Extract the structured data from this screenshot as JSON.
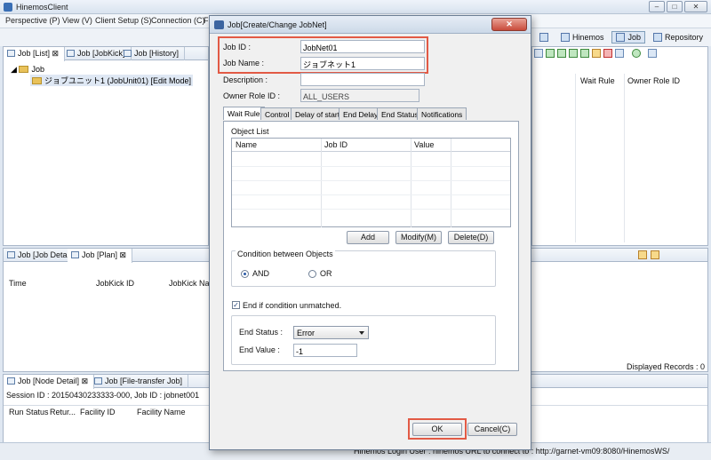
{
  "window": {
    "title": "HinemosClient",
    "min_glyph": "–",
    "max_glyph": "□",
    "close_glyph": "✕"
  },
  "menu": {
    "items": [
      "Perspective (P)",
      "View (V)",
      "Client Setup (S)",
      "Connection (C)",
      "F"
    ]
  },
  "perspectives": {
    "items": [
      "Hinemos",
      "Job",
      "Repository"
    ],
    "active": "Job"
  },
  "left_panel": {
    "tabs": [
      "Job [List]",
      "Job [JobKick]",
      "Job [History]"
    ],
    "tree": {
      "root": "Job",
      "child": "ジョブユニット1 (JobUnit01) [Edit Mode]"
    }
  },
  "right_panel": {
    "columns": [
      "Wait Rule",
      "Owner Role ID"
    ]
  },
  "plan_panel": {
    "tabs": [
      "Job [Job Detail]",
      "Job [Plan]"
    ],
    "columns": [
      "Time",
      "JobKick ID",
      "JobKick Name"
    ],
    "displayed_records": "Displayed Records : 0"
  },
  "node_panel": {
    "tabs": [
      "Job [Node Detail]",
      "Job [File-transfer Job]"
    ],
    "session_line": "Session ID : 20150430233333-000,   Job ID : jobnet001",
    "columns": [
      "Run Status",
      "Retur...",
      "Facility ID",
      "Facility Name"
    ]
  },
  "status": {
    "text": "Hinemos Login User : hinemos      URL to connect to : http://garnet-vm09:8080/HinemosWS/"
  },
  "dialog": {
    "title": "Job[Create/Change JobNet]",
    "close_label": "✕",
    "job_id_label": "Job ID :",
    "job_id_value": "JobNet01",
    "job_name_label": "Job Name :",
    "job_name_value": "ジョブネット1",
    "description_label": "Description :",
    "description_value": "",
    "owner_role_label": "Owner Role ID :",
    "owner_role_value": "ALL_USERS",
    "tabs": [
      "Wait Rule",
      "Control",
      "Delay of start",
      "End Delay",
      "End Status",
      "Notifications"
    ],
    "active_tab": "Wait Rule",
    "object_list_label": "Object List",
    "object_columns": [
      "Name",
      "Job ID",
      "Value"
    ],
    "add_button": "Add",
    "modify_button": "Modify(M)",
    "delete_button": "Delete(D)",
    "condition_group_label": "Condition between Objects",
    "condition_and": "AND",
    "condition_or": "OR",
    "condition_selected": "AND",
    "end_if_unmatched_label": "End if condition unmatched.",
    "end_if_unmatched_checked": true,
    "end_status_label": "End Status :",
    "end_status_value": "Error",
    "end_value_label": "End Value :",
    "end_value_value": "-1",
    "ok_button": "OK",
    "cancel_button": "Cancel(C)"
  },
  "colors": {
    "highlight": "#e25a45",
    "accent": "#2b5ba8"
  }
}
